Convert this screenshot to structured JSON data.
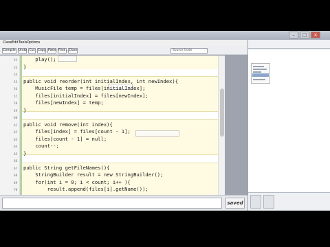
{
  "menu": [
    "Class",
    "Edit",
    "Tools",
    "Options"
  ],
  "toolbar": {
    "buttons": [
      "Compile",
      "Undo",
      "Cut",
      "Copy",
      "Paste",
      "Find...",
      "Close"
    ],
    "search_value": "Source Code"
  },
  "editor": {
    "lines": [
      "    play();",
      "}",
      "",
      "public void reorder(int initialIndex, int newIndex){",
      "    MusicFile temp = files[initialIndex];",
      "    files[initialIndex] = files[newIndex];",
      "    files[newIndex] = temp;",
      "}",
      "",
      "public void remove(int index){",
      "    files[index] = files[count - 1];",
      "    files[count - 1] = null;",
      "    count--;",
      "}",
      "",
      "public String getFileNames(){",
      "    StringBuilder result = new StringBuilder();",
      "    for(int i = 0; i < count; i++ ){",
      "        result.append(files[i].getName());"
    ]
  },
  "status": {
    "saved": "saved"
  }
}
